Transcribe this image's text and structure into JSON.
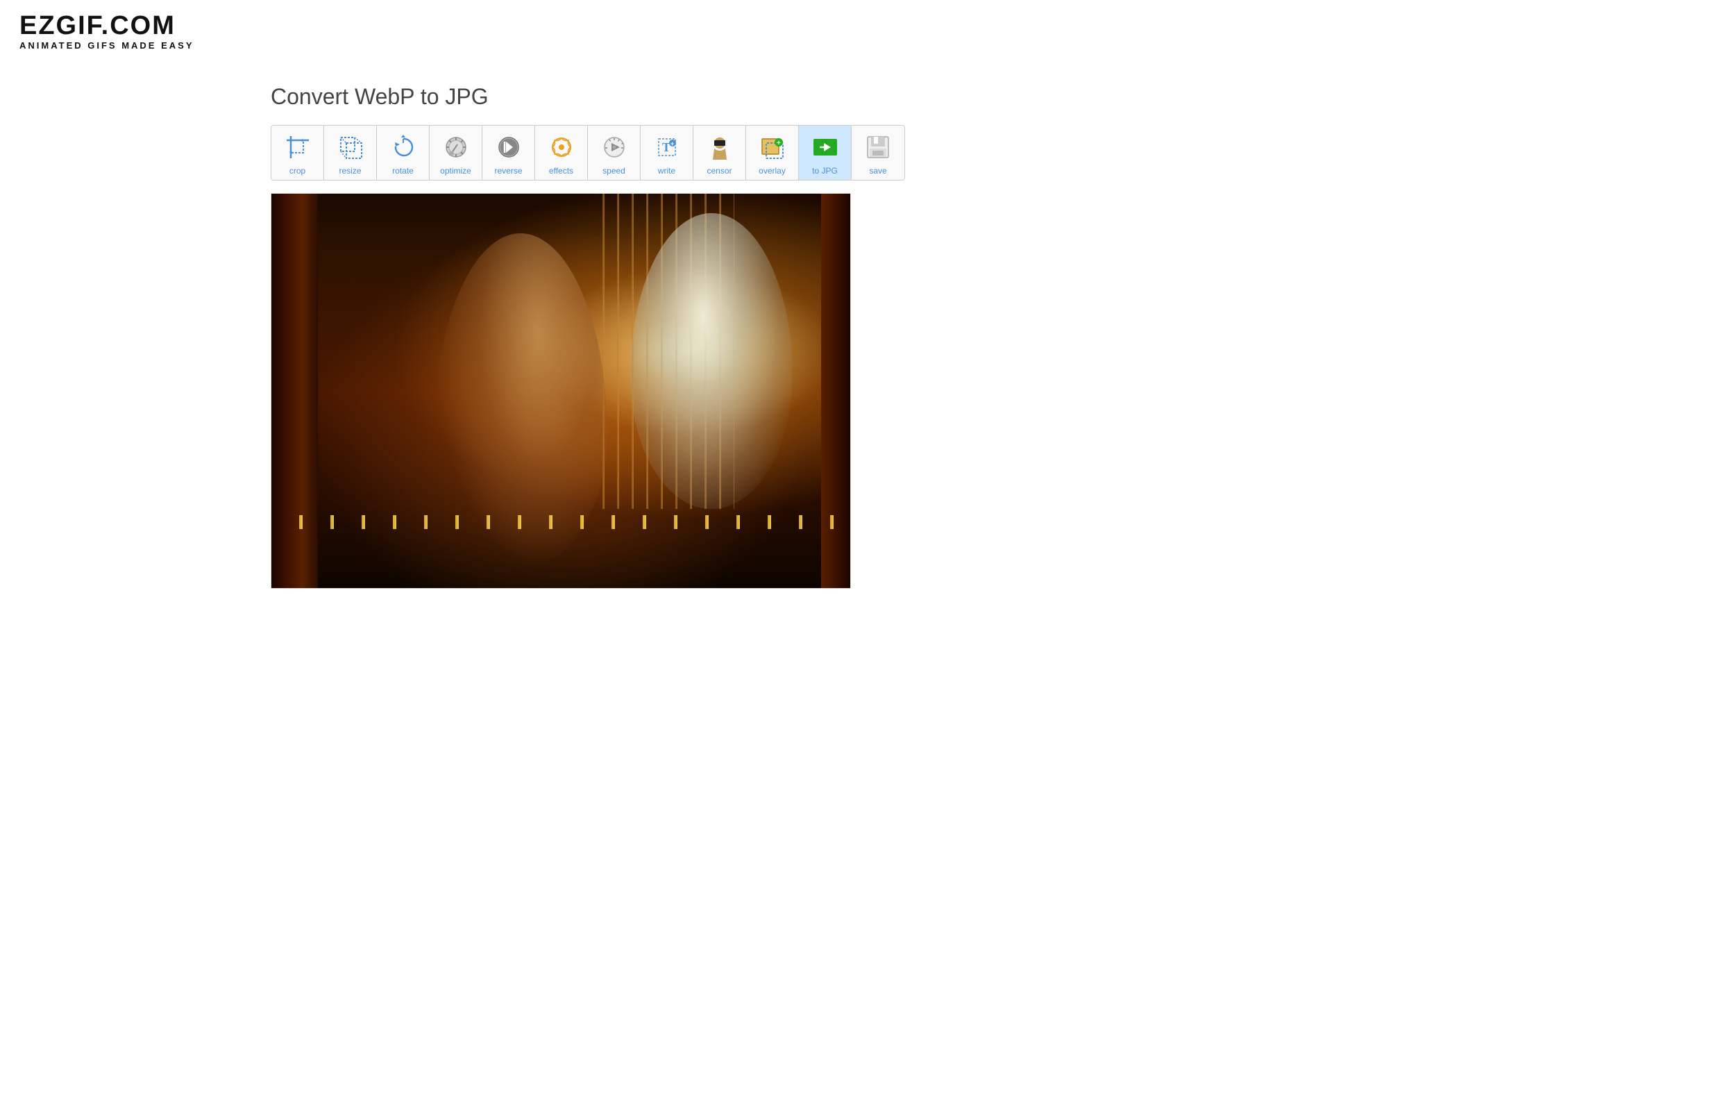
{
  "header": {
    "logo_main": "EZGIF.COM",
    "logo_sub": "ANIMATED GIFS MADE EASY"
  },
  "page": {
    "title": "Convert WebP to JPG"
  },
  "toolbar": {
    "tools": [
      {
        "id": "crop",
        "label": "crop",
        "icon": "crop-icon",
        "active": false
      },
      {
        "id": "resize",
        "label": "resize",
        "icon": "resize-icon",
        "active": false
      },
      {
        "id": "rotate",
        "label": "rotate",
        "icon": "rotate-icon",
        "active": false
      },
      {
        "id": "optimize",
        "label": "optimize",
        "icon": "optimize-icon",
        "active": false
      },
      {
        "id": "reverse",
        "label": "reverse",
        "icon": "reverse-icon",
        "active": false
      },
      {
        "id": "effects",
        "label": "effects",
        "icon": "effects-icon",
        "active": false
      },
      {
        "id": "speed",
        "label": "speed",
        "icon": "speed-icon",
        "active": false
      },
      {
        "id": "write",
        "label": "write",
        "icon": "write-icon",
        "active": false
      },
      {
        "id": "censor",
        "label": "censor",
        "icon": "censor-icon",
        "active": false
      },
      {
        "id": "overlay",
        "label": "overlay",
        "icon": "overlay-icon",
        "active": false
      },
      {
        "id": "to-jpg",
        "label": "to JPG",
        "icon": "tojpg-icon",
        "active": true
      },
      {
        "id": "save",
        "label": "save",
        "icon": "save-icon",
        "active": false
      }
    ]
  }
}
